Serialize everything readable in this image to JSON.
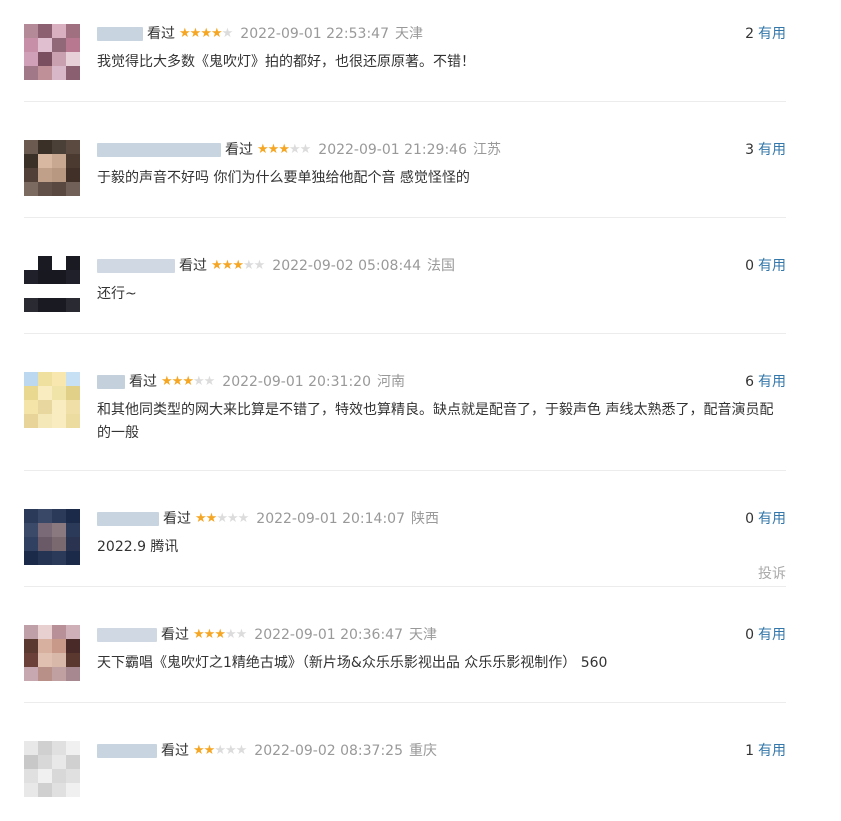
{
  "comments": [
    {
      "watched": "看过",
      "rating": 4,
      "time": "2022-09-01 22:53:47",
      "location": "天津",
      "useful_count": "2",
      "useful_label": "有用",
      "text": "我觉得比大多数《鬼吹灯》拍的都好，也很还原原著。不错！",
      "report": ""
    },
    {
      "watched": "看过",
      "rating": 3,
      "time": "2022-09-01 21:29:46",
      "location": "江苏",
      "useful_count": "3",
      "useful_label": "有用",
      "text": "于毅的声音不好吗 你们为什么要单独给他配个音 感觉怪怪的",
      "report": ""
    },
    {
      "watched": "看过",
      "rating": 3,
      "time": "2022-09-02 05:08:44",
      "location": "法国",
      "useful_count": "0",
      "useful_label": "有用",
      "text": "还行~",
      "report": ""
    },
    {
      "watched": "看过",
      "rating": 3,
      "time": "2022-09-01 20:31:20",
      "location": "河南",
      "useful_count": "6",
      "useful_label": "有用",
      "text": "和其他同类型的网大来比算是不错了，特效也算精良。缺点就是配音了，于毅声色 声线太熟悉了，配音演员配的一般",
      "report": ""
    },
    {
      "watched": "看过",
      "rating": 2,
      "time": "2022-09-01 20:14:07",
      "location": "陕西",
      "useful_count": "0",
      "useful_label": "有用",
      "text": "2022.9 腾讯",
      "report": "投诉"
    },
    {
      "watched": "看过",
      "rating": 3,
      "time": "2022-09-01 20:36:47",
      "location": "天津",
      "useful_count": "0",
      "useful_label": "有用",
      "text": "天下霸唱《鬼吹灯之1精绝古城》（新片场&众乐乐影视出品 众乐乐影视制作） 560",
      "report": ""
    },
    {
      "watched": "看过",
      "rating": 2,
      "time": "2022-09-02 08:37:25",
      "location": "重庆",
      "useful_count": "1",
      "useful_label": "有用",
      "text": "",
      "report": ""
    }
  ],
  "colors": {
    "link": "#3377aa",
    "star_on": "#f5a623",
    "star_off": "#dcdcdc",
    "meta_gray": "#999999"
  },
  "icons": {
    "star": "star-icon"
  }
}
